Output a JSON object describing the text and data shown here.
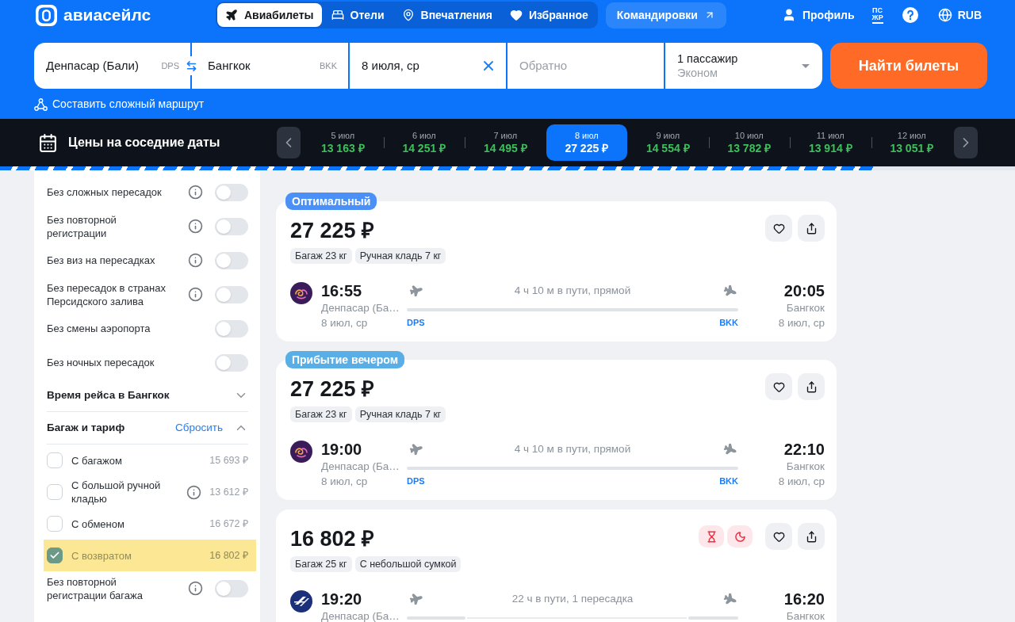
{
  "header": {
    "logo": "авиасейлс",
    "nav": [
      {
        "label": "Авиабилеты",
        "kind": "plane",
        "selected": true
      },
      {
        "label": "Отели",
        "kind": "bed",
        "selected": false
      },
      {
        "label": "Впечатления",
        "kind": "pin",
        "selected": false
      },
      {
        "label": "Избранное",
        "kind": "heart",
        "selected": false
      }
    ],
    "business_link": "Командировки",
    "profile": "Профиль",
    "letters_badge": [
      "ПС",
      "ЖР"
    ],
    "currency": "RUB"
  },
  "search": {
    "origin": {
      "value": "Денпасар (Бали)",
      "code": "DPS"
    },
    "destination": {
      "value": "Бангкок",
      "code": "BKK"
    },
    "date": {
      "value": "8 июля, ср"
    },
    "return_date": {
      "placeholder": "Обратно"
    },
    "passengers": {
      "count": "1 пассажир",
      "cabin": "Эконом"
    },
    "submit": "Найти билеты",
    "complex_route": "Составить сложный маршрут"
  },
  "nearby_dates": {
    "title": "Цены на соседние даты",
    "dates": [
      {
        "date": "5 июл",
        "price": "13 163 ₽",
        "selected": false
      },
      {
        "date": "6 июл",
        "price": "14 251 ₽",
        "selected": false
      },
      {
        "date": "7 июл",
        "price": "14 495 ₽",
        "selected": false
      },
      {
        "date": "8 июл",
        "price": "27 225 ₽",
        "selected": true
      },
      {
        "date": "9 июл",
        "price": "14 554 ₽",
        "selected": false
      },
      {
        "date": "10 июл",
        "price": "13 782 ₽",
        "selected": false
      },
      {
        "date": "11 июл",
        "price": "13 914 ₽",
        "selected": false
      },
      {
        "date": "12 июл",
        "price": "13 051 ₽",
        "selected": false
      }
    ]
  },
  "loading_bar": {
    "level": 0.86
  },
  "sidebar": {
    "filters": [
      {
        "kind": "toggle",
        "label": "Без сложных пересадок",
        "info": true,
        "on": false
      },
      {
        "kind": "toggle",
        "label": "Без повторной регистрации",
        "info": true,
        "on": false
      },
      {
        "kind": "toggle",
        "label": "Без виз на пересадках",
        "info": true,
        "on": false
      },
      {
        "kind": "toggle",
        "label": "Без пересадок в странах Персидского залива",
        "info": true,
        "on": false
      },
      {
        "kind": "toggle",
        "label": "Без смены аэропорта",
        "info": false,
        "on": false
      },
      {
        "kind": "toggle",
        "label": "Без ночных пересадок",
        "info": false,
        "on": false
      },
      {
        "kind": "section",
        "title": "Время рейса в Бангкок",
        "expanded": false
      },
      {
        "kind": "section",
        "title": "Багаж и тариф",
        "reset": "Сбросить",
        "expanded": true
      },
      {
        "kind": "checkbox",
        "label": "С багажом",
        "price": "15 693 ₽",
        "info": false,
        "checked": false,
        "highlighted": false
      },
      {
        "kind": "checkbox",
        "label": "С большой ручной кладью",
        "price": "13 612 ₽",
        "info": true,
        "checked": false,
        "highlighted": false
      },
      {
        "kind": "checkbox",
        "label": "С обменом",
        "price": "16 672 ₽",
        "info": false,
        "checked": false,
        "highlighted": false
      },
      {
        "kind": "checkbox",
        "label": "С возвратом",
        "price": "16 802 ₽",
        "info": false,
        "checked": true,
        "highlighted": true
      },
      {
        "kind": "toggle",
        "label": "Без повторной регистрации багажа",
        "info": true,
        "on": false
      }
    ]
  },
  "results": [
    {
      "badge": {
        "text": "Оптимальный",
        "color": "#4a90f6"
      },
      "price": "27 225 ₽",
      "tags": [
        "Багаж 23 кг",
        "Ручная кладь 7 кг"
      ],
      "flight": {
        "kind": "direct",
        "airline": {
          "kind": "swirl",
          "color": "#3b1c5a"
        },
        "depart": {
          "time": "16:55",
          "city": "Денпасар (Ба…",
          "date": "8 июл, ср",
          "code": "DPS"
        },
        "duration": "4 ч 10 м в пути, прямой",
        "arrive": {
          "time": "20:05",
          "city": "Бангкок",
          "date": "8 июл, ср",
          "code": "BKK"
        }
      }
    },
    {
      "badge": {
        "text": "Прибытие вечером",
        "color": "#5aaee6"
      },
      "price": "27 225 ₽",
      "tags": [
        "Багаж 23 кг",
        "Ручная кладь 7 кг"
      ],
      "flight": {
        "kind": "direct",
        "airline": {
          "kind": "swirl",
          "color": "#3b1c5a"
        },
        "depart": {
          "time": "19:00",
          "city": "Денпасар (Ба…",
          "date": "8 июл, ср",
          "code": "DPS"
        },
        "duration": "4 ч 10 м в пути, прямой",
        "arrive": {
          "time": "22:10",
          "city": "Бангкок",
          "date": "8 июл, ср",
          "code": "BKK"
        }
      }
    },
    {
      "price": "16 802 ₽",
      "alerts": [
        {
          "kind": "hourglass"
        },
        {
          "kind": "night"
        }
      ],
      "tags": [
        "Багаж 25 кг",
        "С небольшой сумкой"
      ],
      "flight": {
        "kind": "transfer",
        "airline": {
          "kind": "wing",
          "color": "#1b2f7a"
        },
        "depart": {
          "time": "19:20",
          "city": "Денпасар (Ба…"
        },
        "duration": "22 ч в пути, 1 пересадка",
        "arrive": {
          "time": "16:20",
          "city": "Бангкок"
        }
      }
    }
  ]
}
